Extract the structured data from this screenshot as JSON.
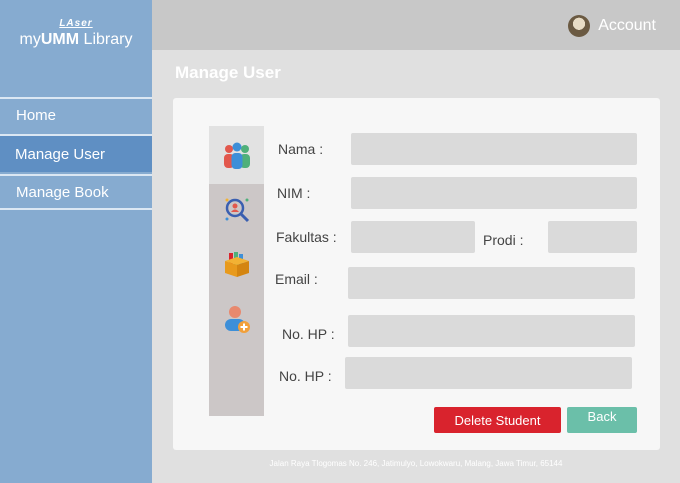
{
  "sidebar": {
    "logo_top": "LAser",
    "logo_prefix": "my",
    "logo_bold": "UMM",
    "logo_suffix": " Library",
    "items": [
      {
        "label": "Home"
      },
      {
        "label": "Manage User"
      },
      {
        "label": "Manage Book"
      }
    ]
  },
  "header": {
    "account_label": "Account"
  },
  "page": {
    "title": "Manage User"
  },
  "form": {
    "nama_label": "Nama :",
    "nim_label": "NIM :",
    "fakultas_label": "Fakultas :",
    "prodi_label": "Prodi :",
    "email_label": "Email :",
    "hp_label_1": "No. HP :",
    "hp_label_2": "No. HP :"
  },
  "actions": {
    "delete_label": "Delete Student",
    "back_label": "Back"
  },
  "footer": {
    "address": "Jalan Raya Tlogomas No. 246, Jatimulyo, Lowokwaru, Malang, Jawa Timur, 65144"
  },
  "icons": [
    "users-group-icon",
    "search-user-icon",
    "books-box-icon",
    "add-user-icon"
  ],
  "colors": {
    "sidebar": "#86abd0",
    "active_nav": "#5f8fc3",
    "delete": "#d9232d",
    "back": "#6bbfa9"
  }
}
